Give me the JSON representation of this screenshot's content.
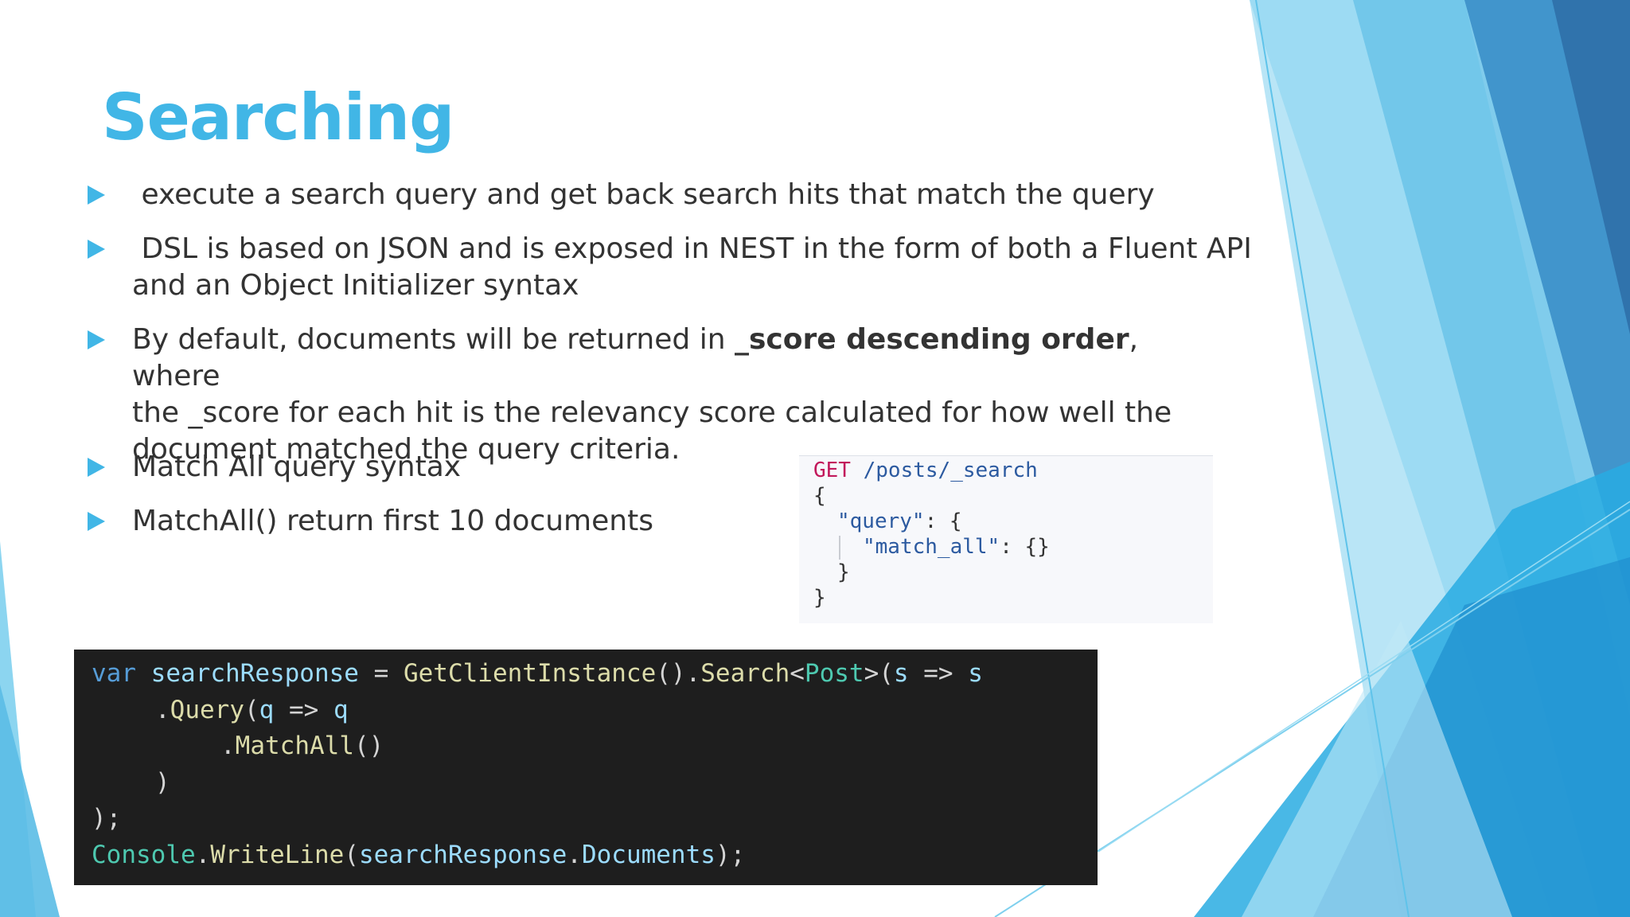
{
  "slide": {
    "title": "Searching",
    "accent_color": "#41b6e6",
    "bullets": [
      {
        "text": " execute a search query and get back search hits that match the query"
      },
      {
        "line1": " DSL is based on JSON and is exposed in NEST in the form of both a Fluent API",
        "line2": "and an Object Initializer syntax"
      },
      {
        "pre": "By default, documents will be returned in ",
        "bold": "_score descending order",
        "post": ", where",
        "line2": "the _score for each hit is the relevancy score calculated for how well the",
        "line3": "document matched the query criteria."
      },
      {
        "text": "Match All query syntax"
      },
      {
        "text": "MatchAll() return first 10 documents"
      }
    ]
  },
  "json_example": {
    "method": "GET",
    "path": "/posts/_search",
    "open_brace": "{",
    "query_key": "\"query\"",
    "query_open": ": {",
    "match_key": "\"match_all\"",
    "match_val": ": {}",
    "inner_close": "}",
    "close_brace": "}"
  },
  "csharp_example": {
    "l1_var": "var",
    "l1_name": "searchResponse",
    "l1_eq": " = ",
    "l1_fn": "GetClientInstance",
    "l1_p1": "().",
    "l1_search": "Search",
    "l1_lt": "<",
    "l1_type": "Post",
    "l1_gt": ">(",
    "l1_s": "s",
    "l1_arrow": " => ",
    "l1_s2": "s",
    "l2_dot": ".",
    "l2_fn": "Query",
    "l2_p": "(",
    "l2_q": "q",
    "l2_arrow": " => ",
    "l2_q2": "q",
    "l3_dot": ".",
    "l3_fn": "MatchAll",
    "l3_p": "()",
    "l4": ")",
    "l5": ");",
    "l6_type": "Console",
    "l6_dot": ".",
    "l6_fn": "WriteLine",
    "l6_p": "(",
    "l6_var": "searchResponse",
    "l6_dot2": ".",
    "l6_prop": "Documents",
    "l6_end": ");"
  }
}
